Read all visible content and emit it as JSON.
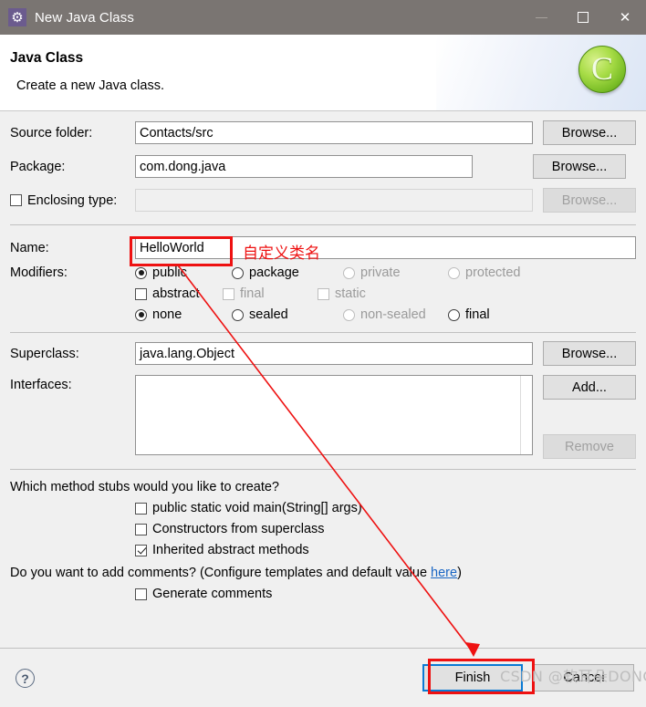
{
  "window": {
    "title": "New Java Class",
    "icon": "gear-icon",
    "controls": {
      "minimize": "—",
      "maximize": "□",
      "close": "✕"
    }
  },
  "header": {
    "title": "Java Class",
    "subtitle": "Create a new Java class.",
    "icon_letter": "C"
  },
  "form": {
    "source_folder": {
      "label": "Source folder:",
      "value": "Contacts/src",
      "button": "Browse..."
    },
    "package": {
      "label": "Package:",
      "value": "com.dong.java",
      "button": "Browse..."
    },
    "enclosing_type": {
      "label": "Enclosing type:",
      "value": "",
      "button": "Browse...",
      "checked": false,
      "enabled": false
    },
    "name": {
      "label": "Name:",
      "value": "HelloWorld"
    },
    "modifiers": {
      "label": "Modifiers:",
      "access": [
        {
          "label": "public",
          "selected": true,
          "enabled": true
        },
        {
          "label": "package",
          "selected": false,
          "enabled": true
        },
        {
          "label": "private",
          "selected": false,
          "enabled": false
        },
        {
          "label": "protected",
          "selected": false,
          "enabled": false
        }
      ],
      "flags": [
        {
          "label": "abstract",
          "checked": false,
          "enabled": true
        },
        {
          "label": "final",
          "checked": false,
          "enabled": false
        },
        {
          "label": "static",
          "checked": false,
          "enabled": false
        }
      ],
      "sealed": [
        {
          "label": "none",
          "selected": true,
          "enabled": true
        },
        {
          "label": "sealed",
          "selected": false,
          "enabled": true
        },
        {
          "label": "non-sealed",
          "selected": false,
          "enabled": false
        },
        {
          "label": "final",
          "selected": false,
          "enabled": true
        }
      ]
    },
    "superclass": {
      "label": "Superclass:",
      "value": "java.lang.Object",
      "button": "Browse..."
    },
    "interfaces": {
      "label": "Interfaces:",
      "items": [],
      "add_button": "Add...",
      "remove_button": "Remove"
    }
  },
  "stubs": {
    "question": "Which method stubs would you like to create?",
    "options": [
      {
        "label": "public static void main(String[] args)",
        "checked": false
      },
      {
        "label": "Constructors from superclass",
        "checked": false
      },
      {
        "label": "Inherited abstract methods",
        "checked": true
      }
    ],
    "comments_question_pre": "Do you want to add comments? (Configure templates and default value ",
    "comments_link": "here",
    "comments_question_post": ")",
    "generate_comments": {
      "label": "Generate comments",
      "checked": false
    }
  },
  "footer": {
    "help_icon": "?",
    "finish_button": "Finish",
    "cancel_button": "Cancel"
  },
  "annotations": {
    "name_note": "自定义类名",
    "highlight_color": "#ee1111",
    "focus_color": "#0a7ad4",
    "watermark": "CSDN @软耳朵DONG"
  }
}
